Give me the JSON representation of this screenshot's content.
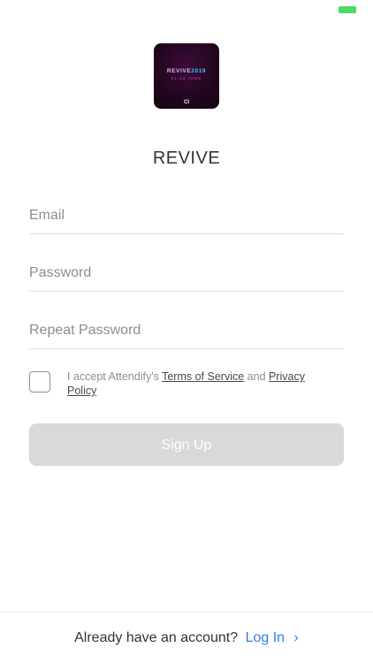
{
  "status_bar": {
    "battery_color": "#4cd964"
  },
  "app_icon": {
    "word": "REVIVE",
    "year": "2019",
    "dates": "21-23 JUNE",
    "mark": "CI"
  },
  "title": "REVIVE",
  "form": {
    "email_placeholder": "Email",
    "password_placeholder": "Password",
    "repeat_password_placeholder": "Repeat Password",
    "terms": {
      "prefix": "I accept Attendify's ",
      "terms_link": "Terms of Service",
      "middle": " and ",
      "privacy_link": "Privacy Policy"
    },
    "signup_label": "Sign Up"
  },
  "footer": {
    "prompt": "Already have an account?",
    "login_label": "Log In",
    "login_icon": "chevron-right-icon",
    "accent_color": "#2f80ed"
  }
}
